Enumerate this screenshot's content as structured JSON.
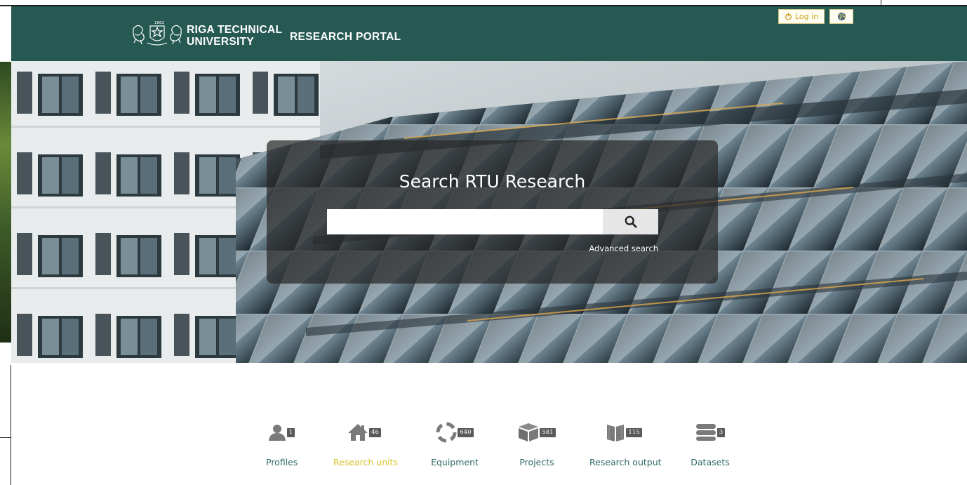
{
  "header": {
    "brand_line1": "RIGA TECHNICAL",
    "brand_line2": "UNIVERSITY",
    "crest_year": "1862",
    "portal_title": "RESEARCH PORTAL",
    "login_label": "Log in",
    "colors": {
      "header_bg": "#255952",
      "button_text": "#c9a21e"
    }
  },
  "hero": {
    "title": "Search RTU Research",
    "search_value": "",
    "search_icon": "search-icon",
    "advanced_label": "Advanced search"
  },
  "categories": [
    {
      "label": "Profiles",
      "count": "1",
      "icon": "person-icon",
      "active": false
    },
    {
      "label": "Research units",
      "count": "46",
      "icon": "house-icon",
      "active": true
    },
    {
      "label": "Equipment",
      "count": "640",
      "icon": "lifebuoy-icon",
      "active": false
    },
    {
      "label": "Projects",
      "count": "581",
      "icon": "box-icon",
      "active": false
    },
    {
      "label": "Research output",
      "count": "115",
      "icon": "book-icon",
      "active": false
    },
    {
      "label": "Datasets",
      "count": "3",
      "icon": "database-icon",
      "active": false
    }
  ],
  "colors": {
    "label": "#2d6a66",
    "active_label": "#d6c22a",
    "icon": "#7a7a7a"
  }
}
